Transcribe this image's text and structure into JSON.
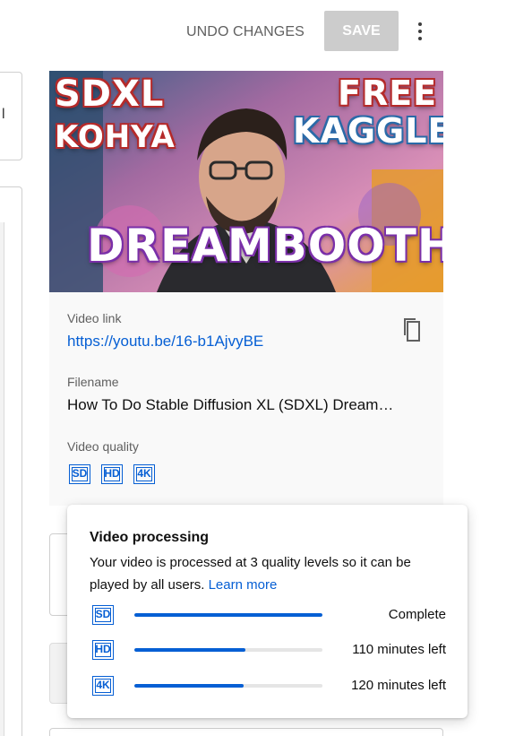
{
  "toolbar": {
    "undo_label": "UNDO CHANGES",
    "save_label": "SAVE",
    "more_icon": "more-vert-icon"
  },
  "left_column": {
    "fragment": "l"
  },
  "thumbnail": {
    "line1": "SDXL",
    "line2": "KOHYA",
    "line3": "FREE",
    "line4": "KAGGLE",
    "line5": "DREAMBOOTH"
  },
  "video": {
    "link_label": "Video link",
    "link": "https://youtu.be/16-b1AjvyBE",
    "copy_icon": "copy-icon",
    "filename_label": "Filename",
    "filename": "How To Do Stable Diffusion XL (SDXL) Dream…",
    "quality_label": "Video quality",
    "qualities": [
      "SD",
      "HD",
      "4K"
    ]
  },
  "processing": {
    "title": "Video processing",
    "description": "Your video is processed at 3 quality levels so it can be played by all users.",
    "learn_more": "Learn more",
    "rows": [
      {
        "quality": "SD",
        "progress": 1.0,
        "status": "Complete"
      },
      {
        "quality": "HD",
        "progress": 0.59,
        "status": "110 minutes left"
      },
      {
        "quality": "4K",
        "progress": 0.58,
        "status": "120 minutes left"
      }
    ],
    "accent": "#065fd4"
  }
}
